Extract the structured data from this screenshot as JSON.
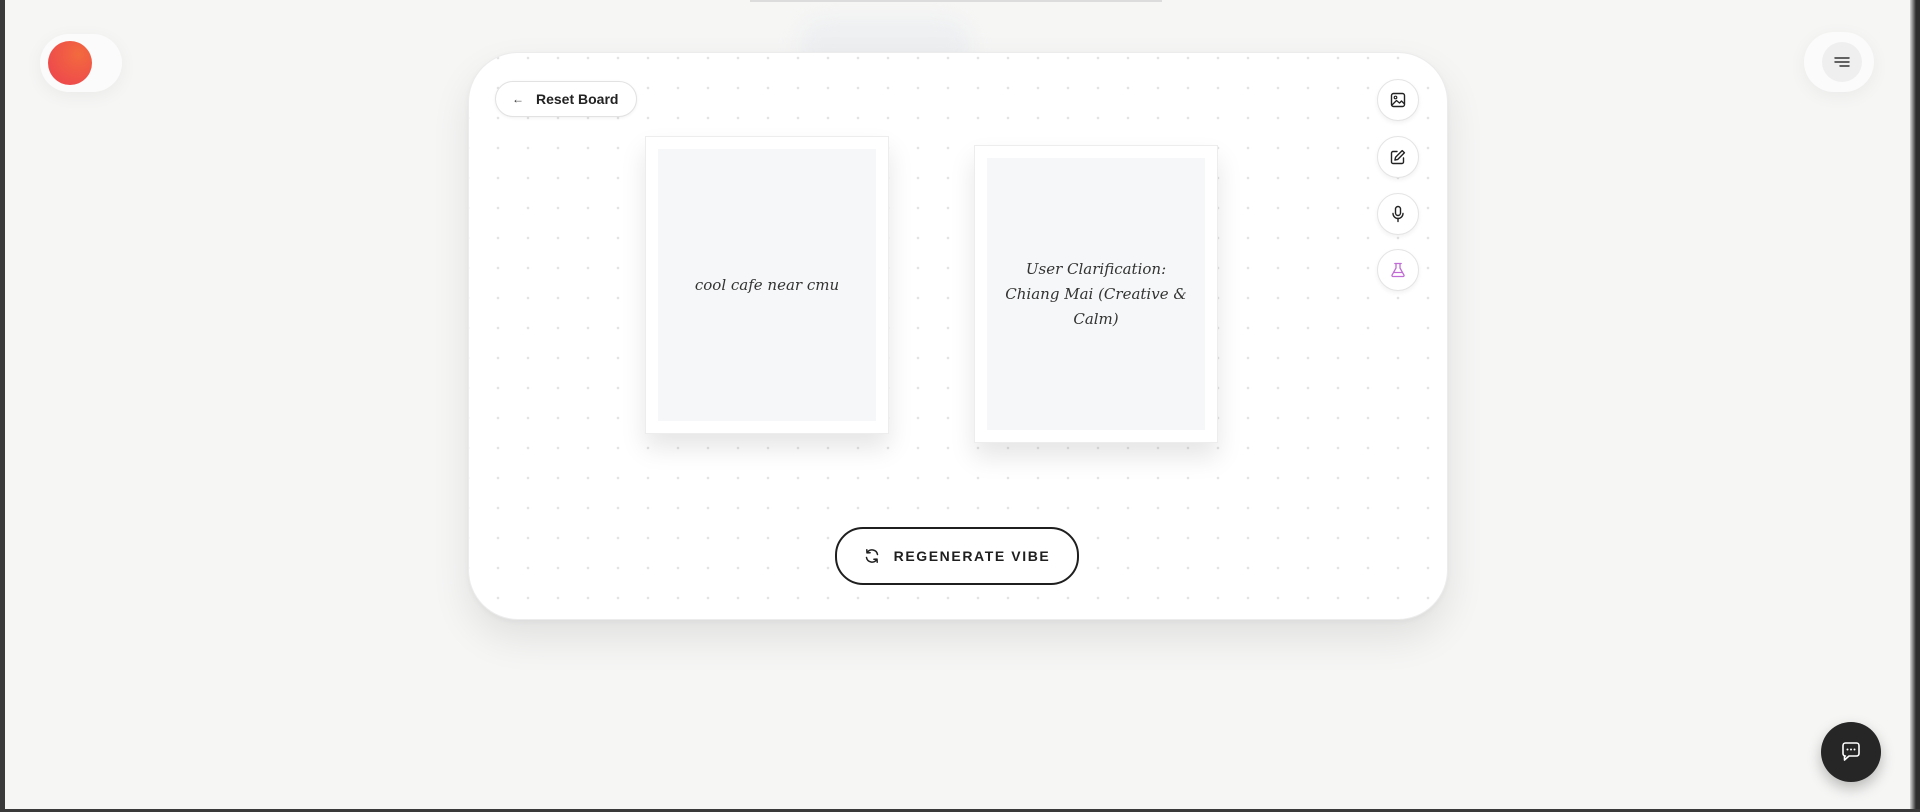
{
  "header": {
    "logo_icon": "orange-gradient-dot",
    "menu_icon": "hamburger-menu-icon"
  },
  "board": {
    "reset_label": "Reset Board",
    "reset_icon": "arrow-left-icon",
    "cards": [
      {
        "text": "cool cafe near cmu"
      },
      {
        "text": "User Clarification: Chiang Mai (Creative & Calm)"
      }
    ],
    "tools": [
      {
        "icon": "image-icon"
      },
      {
        "icon": "edit-icon"
      },
      {
        "icon": "microphone-icon"
      },
      {
        "icon": "flask-icon",
        "color": "#c06bd6"
      }
    ],
    "regenerate_label": "REGENERATE VIBE",
    "regenerate_icon": "refresh-icon"
  },
  "chat": {
    "icon": "chat-bubble-icon"
  },
  "colors": {
    "accent": "#ee5544",
    "dark": "#262626",
    "lab_accent": "#c06bd6"
  }
}
